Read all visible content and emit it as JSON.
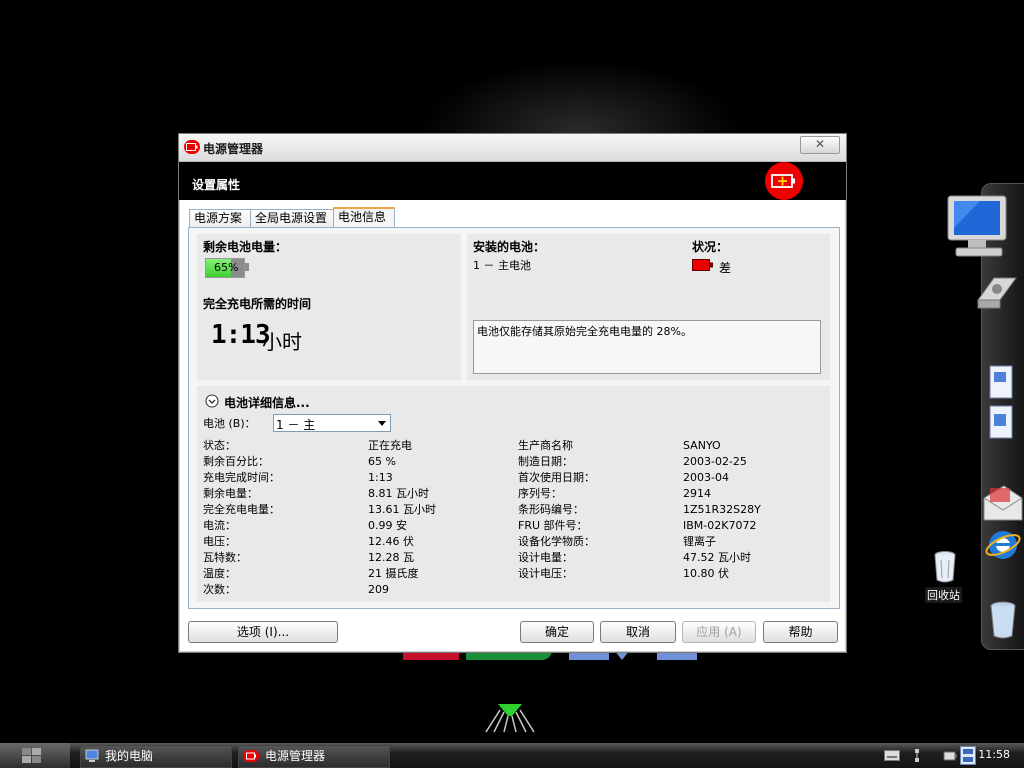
{
  "window": {
    "title": "电源管理器",
    "header_title": "设置属性",
    "close_label": "✕"
  },
  "tabs": [
    {
      "label": "电源方案",
      "active": false
    },
    {
      "label": "全局电源设置",
      "active": false
    },
    {
      "label": "电池信息",
      "active": true
    }
  ],
  "battery_panel": {
    "remaining_label": "剩余电池电量：",
    "remaining_percent": "65%",
    "remaining_fraction": 0.65,
    "charge_time_label": "完全充电所需的时间",
    "charge_time_value": "1:13",
    "charge_time_unit": "小时"
  },
  "installed_panel": {
    "installed_label": "安装的电池：",
    "battery_entry": "1 － 主电池",
    "status_label": "状况：",
    "status_value": "差",
    "message": "电池仅能存储其原始完全充电电量的 28%。"
  },
  "details": {
    "heading": "电池详细信息...",
    "battery_select_label": "电池 (B)：",
    "battery_select_value": "1 － 主",
    "left": [
      {
        "label": "状态：",
        "value": "正在充电"
      },
      {
        "label": "剩余百分比：",
        "value": "65 %"
      },
      {
        "label": "充电完成时间：",
        "value": "1:13"
      },
      {
        "label": "剩余电量：",
        "value": "8.81 瓦小时"
      },
      {
        "label": "完全充电电量：",
        "value": "13.61 瓦小时"
      },
      {
        "label": "电流：",
        "value": "0.99 安"
      },
      {
        "label": "电压：",
        "value": "12.46 伏"
      },
      {
        "label": "瓦特数：",
        "value": "12.28 瓦"
      },
      {
        "label": "温度：",
        "value": "21 摄氏度"
      },
      {
        "label": "次数：",
        "value": "209"
      }
    ],
    "right": [
      {
        "label": "生产商名称",
        "value": "SANYO"
      },
      {
        "label": "制造日期：",
        "value": "2003-02-25"
      },
      {
        "label": "首次使用日期：",
        "value": "2003-04"
      },
      {
        "label": "序列号：",
        "value": "2914"
      },
      {
        "label": "条形码编号：",
        "value": "1Z51R32S28Y"
      },
      {
        "label": "FRU 部件号：",
        "value": "IBM-02K7072"
      },
      {
        "label": "设备化学物质：",
        "value": "锂离子"
      },
      {
        "label": "设计电量：",
        "value": "47.52 瓦小时"
      },
      {
        "label": "设计电压：",
        "value": "10.80 伏"
      }
    ]
  },
  "buttons": {
    "options": "选项 (I)...",
    "ok": "确定",
    "cancel": "取消",
    "apply": "应用 (A)",
    "help": "帮助"
  },
  "desktop": {
    "recycle_bin_label": "回收站"
  },
  "taskbar": {
    "tasks": [
      "我的电脑",
      "电源管理器"
    ],
    "time": "11:58"
  },
  "colors": {
    "accent_red": "#e00000",
    "battery_green": "#3fcf2f"
  }
}
